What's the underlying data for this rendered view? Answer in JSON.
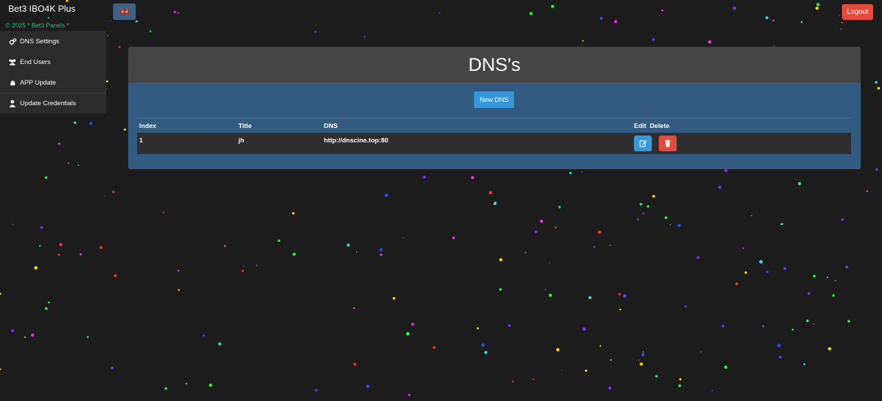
{
  "app": {
    "title": "Bet3 IBO4K Plus",
    "copyright": "© 2025 * Bet3 Panels *",
    "logout_label": "Logout",
    "menu_toggle_icon": "panel-logo-icon"
  },
  "sidebar": {
    "items": [
      {
        "label": "DNS Settings",
        "icon": "gears-icon"
      },
      {
        "label": "End Users",
        "icon": "users-icon"
      },
      {
        "label": "APP Update",
        "icon": "android-icon"
      },
      {
        "label": "Update Credentials",
        "icon": "user-icon"
      }
    ]
  },
  "main": {
    "title": "DNS's",
    "new_button_label": "New DNS",
    "table": {
      "headers": {
        "index": "Index",
        "title": "Title",
        "dns": "DNS",
        "edit": "Edit",
        "delete": "Delete"
      },
      "rows": [
        {
          "index": "1",
          "title": "jh",
          "dns": "http://dnscine.top:80"
        }
      ]
    }
  },
  "colors": {
    "background": "#1c1c1c",
    "sidebar": "#2b2b2b",
    "panel_header": "#454545",
    "panel_body": "#335b82",
    "primary_button": "#3498db",
    "danger_button": "#e54b3c",
    "copyright_text": "#18c37a"
  }
}
